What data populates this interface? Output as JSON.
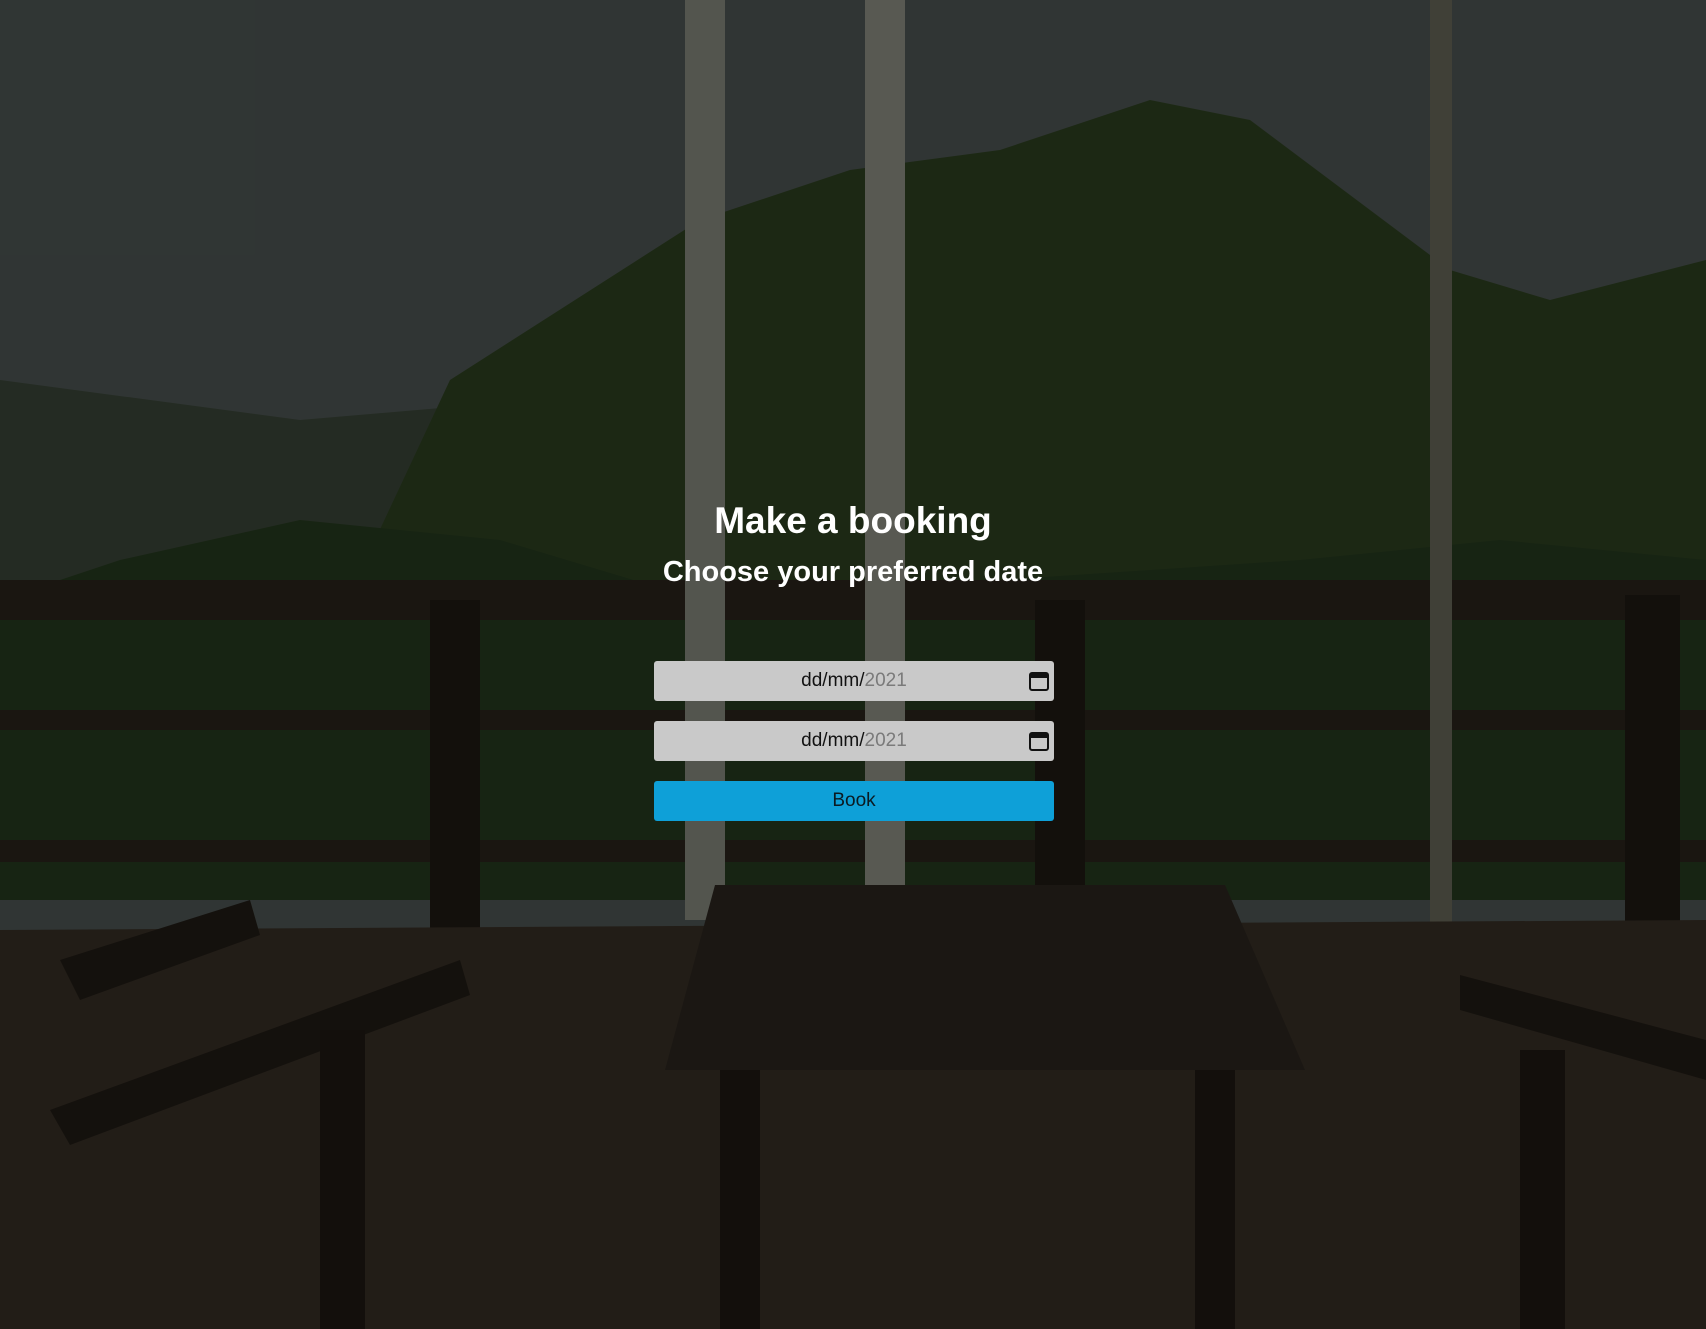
{
  "booking": {
    "title": "Make a booking",
    "subtitle": "Choose your preferred date",
    "start_date": {
      "format": "dd/mm/",
      "year": "2021",
      "icon": "calendar-icon"
    },
    "end_date": {
      "format": "dd/mm/",
      "year": "2021",
      "icon": "calendar-icon"
    },
    "book_label": "Book",
    "colors": {
      "button": "#0ea0d8",
      "field": "#c9c9c9",
      "text": "#ffffff"
    }
  }
}
